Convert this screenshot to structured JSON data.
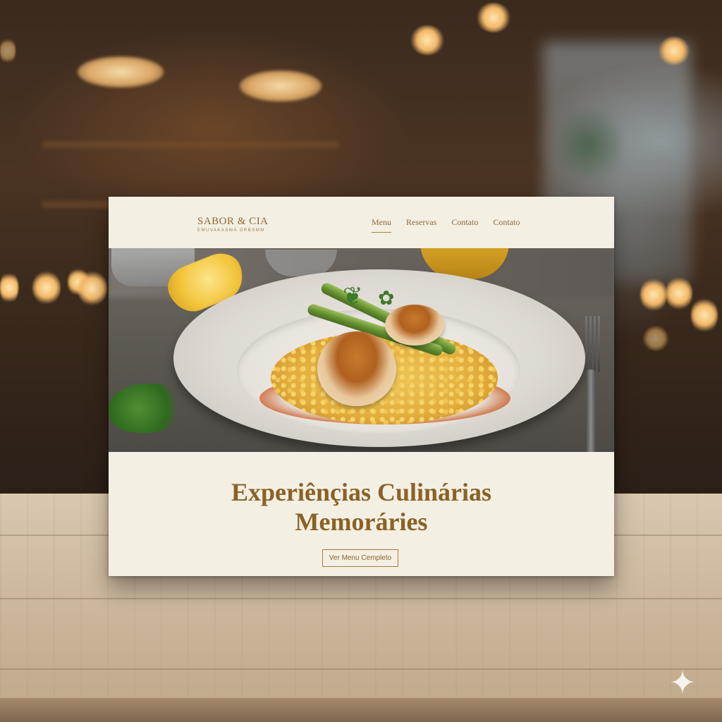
{
  "site": {
    "brand_name": "SABOR & CIA",
    "brand_tagline": "EMUVAKASMÄ DRBSMM"
  },
  "nav": {
    "items": [
      {
        "label": "Menu",
        "active": true
      },
      {
        "label": "Reservas",
        "active": false
      },
      {
        "label": "Contato",
        "active": false
      },
      {
        "label": "Contato",
        "active": false
      }
    ]
  },
  "hero": {
    "image_alt": "seared-scallops-risotto-asparagus-dish",
    "title_line1": "Experiênçias Culinárias",
    "title_line2": "Memoráries",
    "cta_label": "Ver Menu Cempleto"
  },
  "colors": {
    "accent": "#8a6226",
    "page_background": "#f4efe3",
    "border_accent": "#a57e3f"
  },
  "icons": {
    "watermark": "sparkle-icon"
  }
}
